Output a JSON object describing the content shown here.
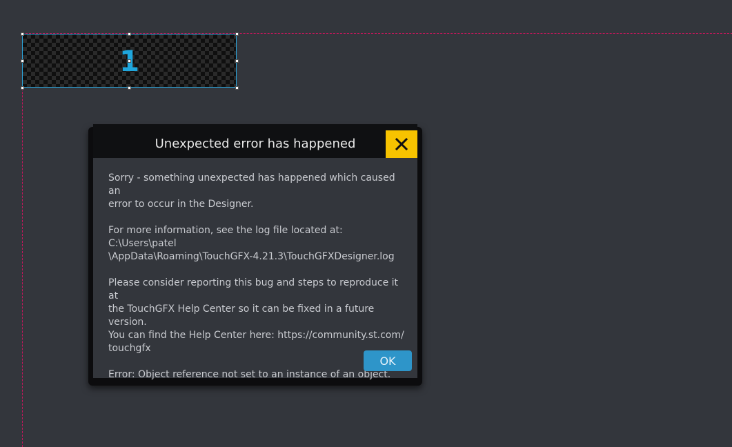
{
  "canvas": {
    "widget": {
      "text": "1"
    }
  },
  "dialog": {
    "title": "Unexpected error has happened",
    "close_icon": "close-icon",
    "paragraphs": [
      "Sorry - something unexpected has happened which caused an\nerror to occur in the Designer.",
      "For more information, see the log file located at: C:\\Users\\patel\n\\AppData\\Roaming\\TouchGFX-4.21.3\\TouchGFXDesigner.log",
      "Please consider reporting this bug and steps to reproduce it at\nthe TouchGFX Help Center so it can be fixed in a future version.\nYou can find the Help Center here: https://community.st.com/\ntouchgfx",
      "Error: Object reference not set to an instance of an object."
    ],
    "ok_label": "OK"
  },
  "colors": {
    "background": "#33363c",
    "accent_blue": "#2e95c9",
    "close_yellow": "#f7c300",
    "boundary_magenta": "#c2185b"
  }
}
